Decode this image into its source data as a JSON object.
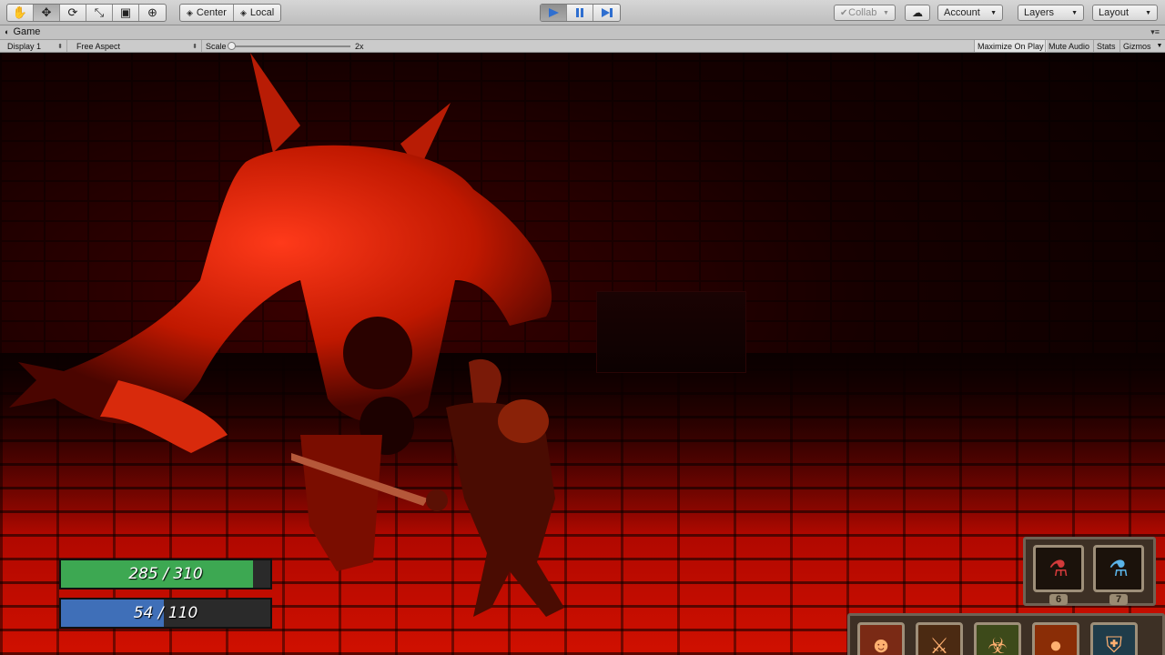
{
  "toolbar": {
    "tools": [
      {
        "name": "hand-tool-icon",
        "glyph": "✋"
      },
      {
        "name": "move-tool-icon",
        "glyph": "✥"
      },
      {
        "name": "rotate-tool-icon",
        "glyph": "⟳"
      },
      {
        "name": "scale-tool-icon",
        "glyph": "⤡"
      },
      {
        "name": "rect-tool-icon",
        "glyph": "▣"
      },
      {
        "name": "transform-tool-icon",
        "glyph": "⊕"
      }
    ],
    "pivot_label": "Center",
    "space_label": "Local",
    "collab_label": "Collab",
    "account_label": "Account",
    "layers_label": "Layers",
    "layout_label": "Layout",
    "accent": "#3a7fd8"
  },
  "game_panel": {
    "tab_label": "Game",
    "display_label": "Display 1",
    "aspect_label": "Free Aspect",
    "scale_label": "Scale",
    "scale_value": "2x",
    "maximize_label": "Maximize On Play",
    "mute_label": "Mute Audio",
    "stats_label": "Stats",
    "gizmos_label": "Gizmos"
  },
  "hud": {
    "health": {
      "text": "285 / 310",
      "current": 285,
      "max": 310,
      "color": "#3da852"
    },
    "mana": {
      "text": "54 / 110",
      "current": 54,
      "max": 110,
      "color": "#3f6fb8"
    },
    "potions": [
      {
        "name": "health-potion-icon",
        "glyph": "⚗",
        "count": "6",
        "color": "#d23a3a"
      },
      {
        "name": "mana-potion-icon",
        "glyph": "⚗",
        "count": "7",
        "color": "#5ab4e8"
      }
    ],
    "skills": [
      {
        "name": "skill-strike-icon",
        "glyph": "☻",
        "bg": "#7a2a15"
      },
      {
        "name": "skill-fire-slash-icon",
        "glyph": "⚔",
        "bg": "#4b2a12"
      },
      {
        "name": "skill-beast-icon",
        "glyph": "☣",
        "bg": "#3d4a1a"
      },
      {
        "name": "skill-fireball-icon",
        "glyph": "●",
        "bg": "#8a2d06"
      },
      {
        "name": "skill-shield-icon",
        "glyph": "⛨",
        "bg": "#1f3c4a"
      }
    ]
  }
}
